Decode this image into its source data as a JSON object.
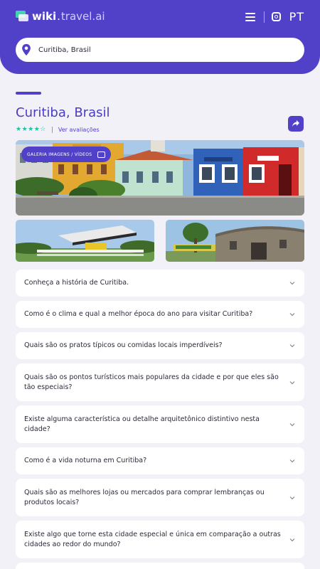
{
  "header": {
    "logo_wiki": "wiki",
    "logo_sep": ".",
    "logo_rest": "travel.ai",
    "lang": "PT",
    "icons": {
      "menu": "hamburger-menu-icon",
      "instagram": "instagram-icon"
    }
  },
  "search": {
    "value": "Curitiba, Brasil"
  },
  "city": {
    "title": "Curitiba, Brasil",
    "stars": "★★★★☆",
    "reviews_link": "Ver avaliações",
    "rating_value": 4
  },
  "gallery": {
    "button_label": "GALERIA IMAGENS / VÍDEOS"
  },
  "faq": [
    {
      "q": "Conheça a história de Curitiba."
    },
    {
      "q": "Como é o clima e qual a melhor época do ano para visitar Curitiba?"
    },
    {
      "q": "Quais são os pratos típicos ou comidas locais imperdíveis?"
    },
    {
      "q": "Quais são os pontos turísticos mais populares da cidade e por que eles são tão especiais?"
    },
    {
      "q": "Existe alguma característica ou detalhe arquitetônico distintivo nesta cidade?"
    },
    {
      "q": "Como é a vida noturna em Curitiba?"
    },
    {
      "q": "Quais são as melhores lojas ou mercados para comprar lembranças ou produtos locais?"
    },
    {
      "q": "Existe algo que torne esta cidade especial e única em comparação a outras cidades ao redor do mundo?"
    }
  ],
  "colors": {
    "brand": "#5141c9",
    "accent": "#1fc1a0",
    "background": "#f1f1f7"
  }
}
